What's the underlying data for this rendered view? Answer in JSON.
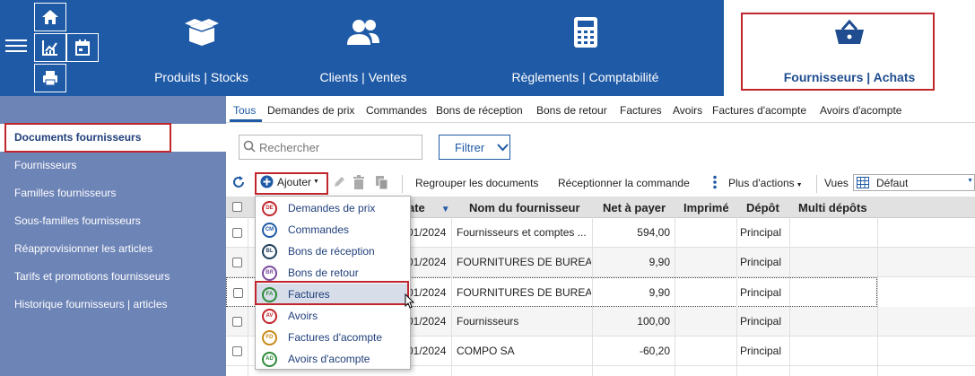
{
  "modules": [
    {
      "label": "Produits | Stocks",
      "icon": "box-open-icon"
    },
    {
      "label": "Clients | Ventes",
      "icon": "users-icon"
    },
    {
      "label": "Règlements | Comptabilité",
      "icon": "calculator-icon"
    },
    {
      "label": "Fournisseurs  |  Achats",
      "icon": "basket-icon",
      "active": true
    }
  ],
  "sidebar": {
    "items": [
      {
        "label": "Documents fournisseurs",
        "active": true
      },
      {
        "label": "Fournisseurs"
      },
      {
        "label": "Familles fournisseurs"
      },
      {
        "label": "Sous-familles fournisseurs"
      },
      {
        "label": "Réapprovisionner les articles"
      },
      {
        "label": "Tarifs et promotions fournisseurs"
      },
      {
        "label": "Historique fournisseurs | articles"
      }
    ]
  },
  "tabs": [
    "Tous",
    "Demandes de prix",
    "Commandes",
    "Bons de réception",
    "Bons de retour",
    "Factures",
    "Avoirs",
    "Factures d'acompte",
    "Avoirs d'acompte"
  ],
  "search": {
    "placeholder": "Rechercher"
  },
  "filter": {
    "label": "Filtrer"
  },
  "toolbar": {
    "add_label": "Ajouter",
    "group_label": "Regrouper les documents",
    "receive_label": "Réceptionner la commande",
    "more_label": "Plus d'actions",
    "views_label": "Vues",
    "views_value": "Défaut"
  },
  "table": {
    "headers": [
      "ate",
      "Nom du fournisseur",
      "Net à payer",
      "Imprimé",
      "Dépôt",
      "Multi dépôts"
    ],
    "rows": [
      {
        "date": "01/2024",
        "name": "Fournisseurs et comptes ...",
        "net": "594,00",
        "depot": "Principal"
      },
      {
        "date": "01/2024",
        "name": "FOURNITURES DE BUREAU",
        "net": "9,90",
        "depot": "Principal"
      },
      {
        "date": "01/2024",
        "name": "FOURNITURES DE BUREAU",
        "net": "9,90",
        "depot": "Principal"
      },
      {
        "date": "01/2024",
        "name": "Fournisseurs",
        "net": "100,00",
        "depot": "Principal"
      },
      {
        "date": "01/2024",
        "name": "COMPO SA",
        "net": "-60,20",
        "depot": "Principal"
      }
    ]
  },
  "menu": {
    "items": [
      {
        "code": "DE",
        "label": "Demandes de prix",
        "color": "#c0262c"
      },
      {
        "code": "CM",
        "label": "Commandes",
        "color": "#1f5aa6"
      },
      {
        "code": "BL",
        "label": "Bons de réception",
        "color": "#1f5aa6"
      },
      {
        "code": "BR",
        "label": "Bons de retour",
        "color": "#7a4a9c"
      },
      {
        "code": "FA",
        "label": "Factures",
        "color": "#2e8b3a"
      },
      {
        "code": "AV",
        "label": "Avoirs",
        "color": "#c0262c"
      },
      {
        "code": "FD",
        "label": "Factures d'acompte",
        "color": "#c88a1a"
      },
      {
        "code": "AD",
        "label": "Avoirs d'acompte",
        "color": "#2e8b3a"
      }
    ]
  },
  "colors": {
    "primary": "#1f5aa6",
    "sidebar": "#6d84b7",
    "highlight": "#c0262c"
  }
}
